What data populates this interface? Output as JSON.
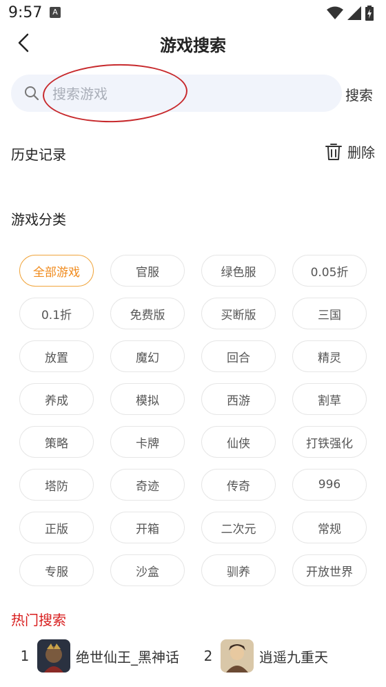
{
  "status_bar": {
    "time": "9:57",
    "notification_letter": "A"
  },
  "header": {
    "title": "游戏搜索"
  },
  "search": {
    "placeholder": "搜索游戏",
    "button_label": "搜索"
  },
  "history": {
    "title": "历史记录",
    "delete_label": "删除"
  },
  "categories": {
    "title": "游戏分类",
    "items": [
      "全部游戏",
      "官服",
      "绿色服",
      "0.05折",
      "0.1折",
      "免费版",
      "买断版",
      "三国",
      "放置",
      "魔幻",
      "回合",
      "精灵",
      "养成",
      "模拟",
      "西游",
      "割草",
      "策略",
      "卡牌",
      "仙侠",
      "打铁强化",
      "塔防",
      "奇迹",
      "传奇",
      "996",
      "正版",
      "开箱",
      "二次元",
      "常规",
      "专服",
      "沙盒",
      "驯养",
      "开放世界"
    ],
    "active_index": 0
  },
  "hot_search": {
    "title": "热门搜索",
    "items": [
      {
        "rank": "1",
        "name": "绝世仙王_黑神话"
      },
      {
        "rank": "2",
        "name": "逍遥九重天"
      }
    ]
  },
  "colors": {
    "accent_orange": "#f08a1c",
    "hot_red": "#d81e1e",
    "search_bg": "#f1f4fb",
    "annotation_red": "#c7292c"
  }
}
